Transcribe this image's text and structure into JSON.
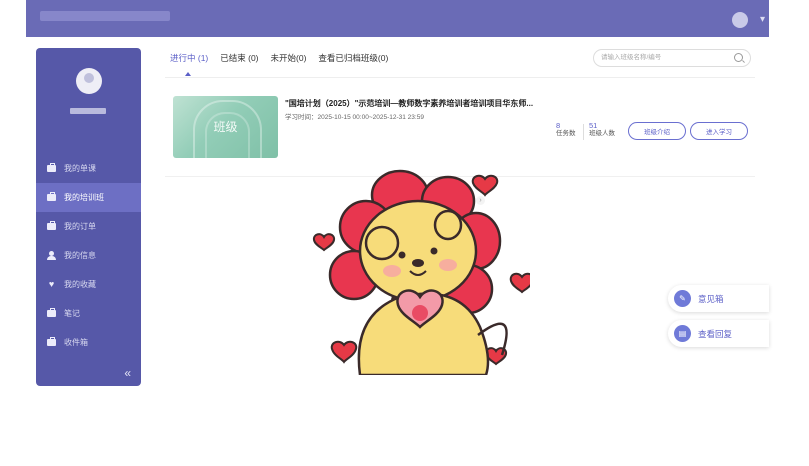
{
  "tabs": {
    "in_progress": "进行中 (1)",
    "ended": "已结束 (0)",
    "not_started": "未开始(0)",
    "archived": "查看已归档班级(0)"
  },
  "search": {
    "placeholder": "请输入班级名称/编号",
    "icon": "search-icon"
  },
  "sidebar": {
    "items": [
      {
        "label": "我的单课",
        "icon": "briefcase-icon"
      },
      {
        "label": "我的培训班",
        "icon": "briefcase-icon",
        "active": true
      },
      {
        "label": "我的订单",
        "icon": "briefcase-icon"
      },
      {
        "label": "我的信息",
        "icon": "user-icon"
      },
      {
        "label": "我的收藏",
        "icon": "heart-icon"
      },
      {
        "label": "笔记",
        "icon": "briefcase-icon"
      },
      {
        "label": "收件箱",
        "icon": "briefcase-icon"
      }
    ],
    "collapse": "«"
  },
  "course": {
    "thumb_label": "班级",
    "title": "\"国培计划（2025）\"示范培训—教师数字素养培训者培训项目华东师...",
    "time": "学习时间：2025-10-15 00:00~2025-12-31 23:59",
    "task_count": "8",
    "task_label": "任务数",
    "member_count": "51",
    "member_label": "班级人数",
    "intro_button": "班级介绍",
    "enter_button": "进入学习"
  },
  "float": {
    "feedback": "意见箱",
    "replies": "查看回复"
  },
  "colors": {
    "accent": "#5b5fc7",
    "sidebar": "#5658a8",
    "topbar": "#6a6bb6"
  }
}
